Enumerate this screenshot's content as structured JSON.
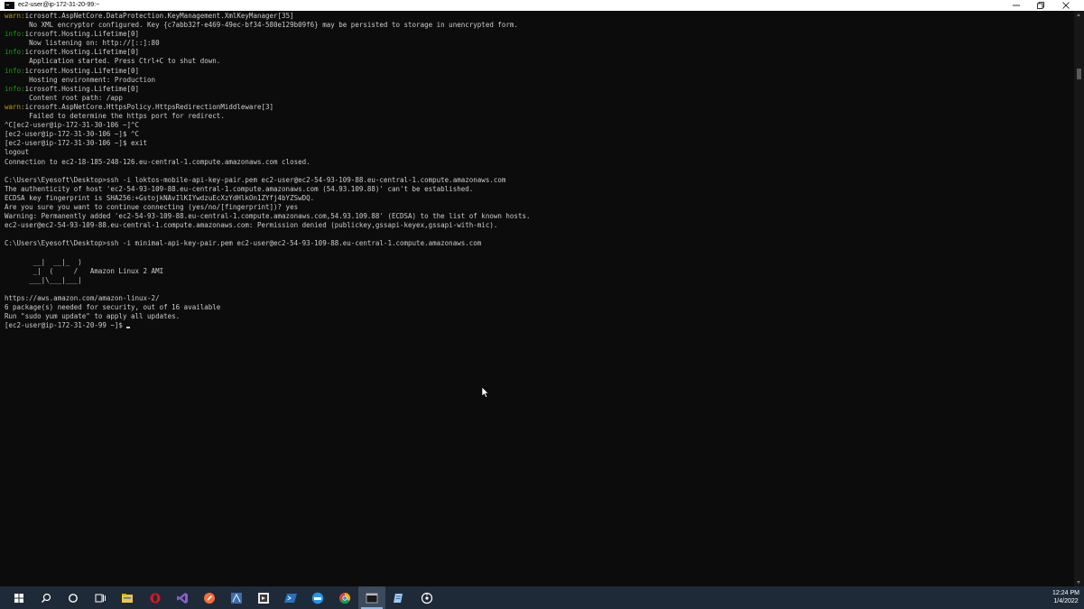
{
  "window": {
    "title": "ec2-user@ip-172-31-20-99:~",
    "icon": "console-icon",
    "controls": [
      "minimize-icon",
      "maximize-icon",
      "close-icon"
    ]
  },
  "colors": {
    "terminal_bg": "#0c0c0c",
    "terminal_fg": "#cccccc",
    "warn": "#c19c00",
    "info": "#13a10e",
    "taskbar_bg": "#1f2a38"
  },
  "terminal": {
    "lines": [
      {
        "level": "warn",
        "text": "    Microsoft.AspNetCore.DataProtection.KeyManagement.XmlKeyManager[35]"
      },
      {
        "text": "      No XML encryptor configured. Key {c7abb32f-e469-49ec-bf34-580e129b09f6} may be persisted to storage in unencrypted form."
      },
      {
        "level": "info",
        "text": "    Microsoft.Hosting.Lifetime[0]"
      },
      {
        "text": "      Now listening on: http://[::]:80"
      },
      {
        "level": "info",
        "text": "    Microsoft.Hosting.Lifetime[0]"
      },
      {
        "text": "      Application started. Press Ctrl+C to shut down."
      },
      {
        "level": "info",
        "text": "    Microsoft.Hosting.Lifetime[0]"
      },
      {
        "text": "      Hosting environment: Production"
      },
      {
        "level": "info",
        "text": "    Microsoft.Hosting.Lifetime[0]"
      },
      {
        "text": "      Content root path: /app"
      },
      {
        "level": "warn",
        "text": "    Microsoft.AspNetCore.HttpsPolicy.HttpsRedirectionMiddleware[3]"
      },
      {
        "text": "      Failed to determine the https port for redirect."
      },
      {
        "text": "^C[ec2-user@ip-172-31-30-106 ~]^C"
      },
      {
        "text": "[ec2-user@ip-172-31-30-106 ~]$ ^C"
      },
      {
        "text": "[ec2-user@ip-172-31-30-106 ~]$ exit"
      },
      {
        "text": "logout"
      },
      {
        "text": "Connection to ec2-18-185-248-126.eu-central-1.compute.amazonaws.com closed."
      },
      {
        "text": ""
      },
      {
        "text": "C:\\Users\\Eyesoft\\Desktop>ssh -i loktos-mobile-api-key-pair.pem ec2-user@ec2-54-93-109-88.eu-central-1.compute.amazonaws.com"
      },
      {
        "text": "The authenticity of host 'ec2-54-93-109-88.eu-central-1.compute.amazonaws.com (54.93.109.88)' can't be established."
      },
      {
        "text": "ECDSA key fingerprint is SHA256:+GstojkNAvIlKIYwdzuEcXzYdHlkOn1ZYfj4bYZSwDQ."
      },
      {
        "text": "Are you sure you want to continue connecting (yes/no/[fingerprint])? yes"
      },
      {
        "text": "Warning: Permanently added 'ec2-54-93-109-88.eu-central-1.compute.amazonaws.com,54.93.109.88' (ECDSA) to the list of known hosts."
      },
      {
        "text": "ec2-user@ec2-54-93-109-88.eu-central-1.compute.amazonaws.com: Permission denied (publickey,gssapi-keyex,gssapi-with-mic)."
      },
      {
        "text": ""
      },
      {
        "text": "C:\\Users\\Eyesoft\\Desktop>ssh -i minimal-api-key-pair.pem ec2-user@ec2-54-93-109-88.eu-central-1.compute.amazonaws.com"
      },
      {
        "text": ""
      },
      {
        "text": "       __|  __|_  )"
      },
      {
        "text": "       _|  (     /   Amazon Linux 2 AMI"
      },
      {
        "text": "      ___|\\___|___|"
      },
      {
        "text": ""
      },
      {
        "text": "https://aws.amazon.com/amazon-linux-2/"
      },
      {
        "text": "6 package(s) needed for security, out of 16 available"
      },
      {
        "text": "Run \"sudo yum update\" to apply all updates."
      },
      {
        "text": "[ec2-user@ip-172-31-20-99 ~]$ ",
        "cursor": true
      }
    ]
  },
  "taskbar": {
    "items": [
      {
        "name": "start-button-windows-icon",
        "icon": "windows",
        "interactable": true
      },
      {
        "name": "search-icon",
        "icon": "search",
        "interactable": true
      },
      {
        "name": "cortana-icon",
        "icon": "cortana",
        "interactable": true
      },
      {
        "name": "task-view-icon",
        "icon": "taskview",
        "interactable": true
      },
      {
        "name": "file-explorer-icon",
        "icon": "explorer",
        "interactable": true
      },
      {
        "name": "opera-browser-icon",
        "icon": "opera",
        "interactable": true
      },
      {
        "name": "visual-studio-icon",
        "icon": "vs",
        "interactable": true
      },
      {
        "name": "postman-icon",
        "icon": "postman",
        "interactable": true
      },
      {
        "name": "app-blue-icon",
        "icon": "blueapp",
        "interactable": true
      },
      {
        "name": "app-dark-icon",
        "icon": "darkapp",
        "interactable": true
      },
      {
        "name": "powershell-icon",
        "icon": "powershell",
        "interactable": true
      },
      {
        "name": "docker-icon",
        "icon": "docker",
        "interactable": true
      },
      {
        "name": "chrome-icon",
        "icon": "chrome",
        "interactable": true
      },
      {
        "name": "command-prompt-icon",
        "icon": "cmd",
        "interactable": true,
        "active": true
      },
      {
        "name": "notepad-icon",
        "icon": "notepad",
        "interactable": true
      },
      {
        "name": "settings-app-icon",
        "icon": "circle",
        "interactable": true
      }
    ],
    "clock": {
      "time": "12:24 PM",
      "date": "1/4/2022"
    }
  }
}
